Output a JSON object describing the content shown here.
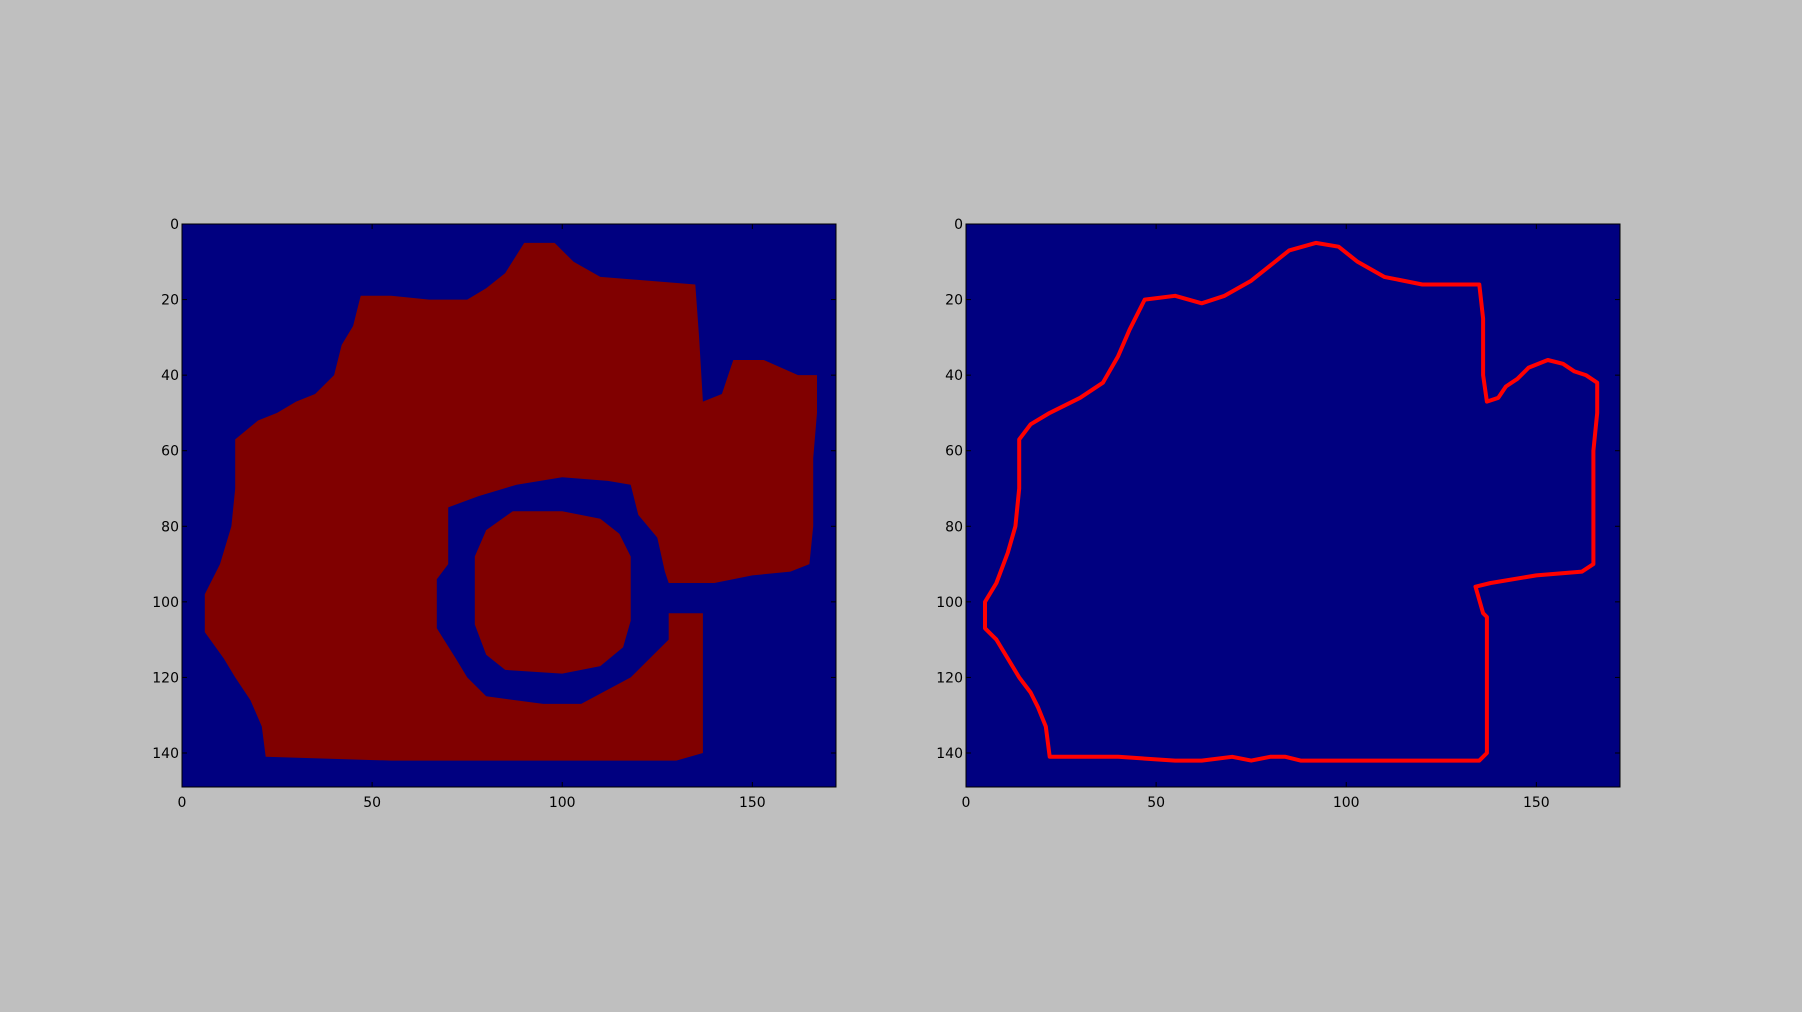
{
  "figure": {
    "background": "#bfbfbf"
  },
  "chart_data": [
    {
      "type": "heatmap",
      "title": "",
      "xlabel": "",
      "ylabel": "",
      "image_size": [
        172,
        149
      ],
      "xlim": [
        0,
        172
      ],
      "ylim": [
        149,
        0
      ],
      "xticks": [
        0,
        50,
        100,
        150
      ],
      "yticks": [
        0,
        20,
        40,
        60,
        80,
        100,
        120,
        140
      ],
      "background_color": "#000080",
      "foreground_color": "#800000",
      "filled_region": [
        [
          90,
          5
        ],
        [
          98,
          5
        ],
        [
          103,
          10
        ],
        [
          110,
          14
        ],
        [
          135,
          16
        ],
        [
          136,
          30
        ],
        [
          137,
          47
        ],
        [
          142,
          45
        ],
        [
          145,
          36
        ],
        [
          153,
          36
        ],
        [
          162,
          40
        ],
        [
          167,
          40
        ],
        [
          167,
          50
        ],
        [
          166,
          62
        ],
        [
          166,
          80
        ],
        [
          165,
          90
        ],
        [
          160,
          92
        ],
        [
          150,
          93
        ],
        [
          140,
          95
        ],
        [
          128,
          95
        ],
        [
          127,
          92
        ],
        [
          125,
          83
        ],
        [
          120,
          77
        ],
        [
          118,
          69
        ],
        [
          112,
          68
        ],
        [
          100,
          67
        ],
        [
          88,
          69
        ],
        [
          78,
          72
        ],
        [
          70,
          75
        ],
        [
          70,
          90
        ],
        [
          67,
          94
        ],
        [
          67,
          107
        ],
        [
          72,
          115
        ],
        [
          75,
          120
        ],
        [
          80,
          125
        ],
        [
          95,
          127
        ],
        [
          105,
          127
        ],
        [
          118,
          120
        ],
        [
          122,
          116
        ],
        [
          128,
          110
        ],
        [
          128,
          103
        ],
        [
          137,
          103
        ],
        [
          137,
          140
        ],
        [
          130,
          142
        ],
        [
          100,
          142
        ],
        [
          80,
          142
        ],
        [
          55,
          142
        ],
        [
          22,
          141
        ],
        [
          21,
          133
        ],
        [
          18,
          126
        ],
        [
          14,
          120
        ],
        [
          11,
          115
        ],
        [
          6,
          108
        ],
        [
          6,
          98
        ],
        [
          10,
          90
        ],
        [
          13,
          80
        ],
        [
          14,
          70
        ],
        [
          14,
          57
        ],
        [
          20,
          52
        ],
        [
          25,
          50
        ],
        [
          30,
          47
        ],
        [
          35,
          45
        ],
        [
          40,
          40
        ],
        [
          42,
          32
        ],
        [
          45,
          27
        ],
        [
          47,
          19
        ],
        [
          55,
          19
        ],
        [
          65,
          20
        ],
        [
          75,
          20
        ],
        [
          80,
          17
        ],
        [
          85,
          13
        ]
      ],
      "hole_region": [
        [
          87,
          76
        ],
        [
          100,
          76
        ],
        [
          110,
          78
        ],
        [
          115,
          82
        ],
        [
          118,
          88
        ],
        [
          118,
          105
        ],
        [
          116,
          112
        ],
        [
          110,
          117
        ],
        [
          100,
          119
        ],
        [
          85,
          118
        ],
        [
          80,
          114
        ],
        [
          77,
          106
        ],
        [
          77,
          88
        ],
        [
          80,
          81
        ]
      ]
    },
    {
      "type": "heatmap",
      "title": "",
      "xlabel": "",
      "ylabel": "",
      "image_size": [
        172,
        149
      ],
      "xlim": [
        0,
        172
      ],
      "ylim": [
        149,
        0
      ],
      "xticks": [
        0,
        50,
        100,
        150
      ],
      "yticks": [
        0,
        20,
        40,
        60,
        80,
        100,
        120,
        140
      ],
      "background_color": "#000080",
      "foreground_color": "#ff0000",
      "outline": [
        [
          5,
          107
        ],
        [
          5,
          100
        ],
        [
          8,
          95
        ],
        [
          11,
          87
        ],
        [
          13,
          80
        ],
        [
          14,
          70
        ],
        [
          14,
          57
        ],
        [
          17,
          53
        ],
        [
          22,
          50
        ],
        [
          30,
          46
        ],
        [
          36,
          42
        ],
        [
          40,
          35
        ],
        [
          43,
          28
        ],
        [
          47,
          20
        ],
        [
          55,
          19
        ],
        [
          62,
          21
        ],
        [
          68,
          19
        ],
        [
          75,
          15
        ],
        [
          80,
          11
        ],
        [
          85,
          7
        ],
        [
          92,
          5
        ],
        [
          98,
          6
        ],
        [
          103,
          10
        ],
        [
          110,
          14
        ],
        [
          120,
          16
        ],
        [
          135,
          16
        ],
        [
          136,
          25
        ],
        [
          136,
          40
        ],
        [
          137,
          47
        ],
        [
          140,
          46
        ],
        [
          142,
          43
        ],
        [
          145,
          41
        ],
        [
          148,
          38
        ],
        [
          153,
          36
        ],
        [
          157,
          37
        ],
        [
          160,
          39
        ],
        [
          163,
          40
        ],
        [
          166,
          42
        ],
        [
          166,
          50
        ],
        [
          165,
          60
        ],
        [
          165,
          75
        ],
        [
          165,
          90
        ],
        [
          162,
          92
        ],
        [
          150,
          93
        ],
        [
          138,
          95
        ],
        [
          134,
          96
        ],
        [
          136,
          103
        ],
        [
          137,
          104
        ],
        [
          137,
          140
        ],
        [
          135,
          142
        ],
        [
          130,
          142
        ],
        [
          100,
          142
        ],
        [
          88,
          142
        ],
        [
          84,
          141
        ],
        [
          80,
          141
        ],
        [
          75,
          142
        ],
        [
          70,
          141
        ],
        [
          62,
          142
        ],
        [
          55,
          142
        ],
        [
          40,
          141
        ],
        [
          25,
          141
        ],
        [
          22,
          141
        ],
        [
          21,
          133
        ],
        [
          19,
          128
        ],
        [
          17,
          124
        ],
        [
          14,
          120
        ],
        [
          11,
          115
        ],
        [
          8,
          110
        ]
      ]
    }
  ]
}
